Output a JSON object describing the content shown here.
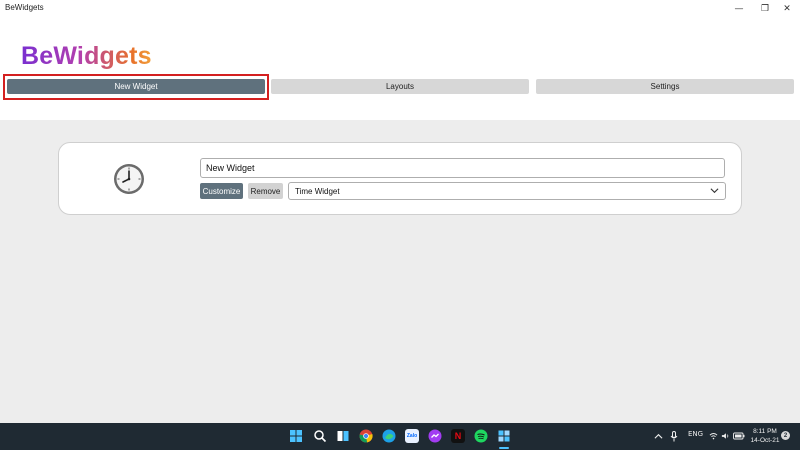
{
  "window": {
    "title": "BeWidgets",
    "controls": {
      "minimize": "—",
      "restore": "❐",
      "close": "✕"
    }
  },
  "app": {
    "logo_text": "BeWidgets",
    "logo_gradient": [
      "#7a2fd0",
      "#b23fae",
      "#e8722b",
      "#f2a13a"
    ]
  },
  "tabs": [
    {
      "label": "New Widget",
      "active": true
    },
    {
      "label": "Layouts",
      "active": false
    },
    {
      "label": "Settings",
      "active": false
    }
  ],
  "widget": {
    "icon": "clock-icon",
    "name_value": "New Widget",
    "customize_label": "Customize",
    "remove_label": "Remove",
    "type_selected": "Time Widget"
  },
  "taskbar": {
    "apps": [
      "windows-start-icon",
      "search-icon",
      "task-view-icon",
      "chrome-icon",
      "edge-icon",
      "zalo-icon",
      "messenger-icon",
      "netflix-icon",
      "spotify-icon",
      "bewidgets-app-icon"
    ],
    "zalo_label": "Zalo",
    "netflix_label": "N",
    "language": "ENG",
    "time": "8:11 PM",
    "date": "14-Oct-21",
    "notification_count": "2"
  },
  "colors": {
    "accent": "#5f717d",
    "highlight_box": "#d42020",
    "taskbar_bg": "#1f2a33"
  }
}
